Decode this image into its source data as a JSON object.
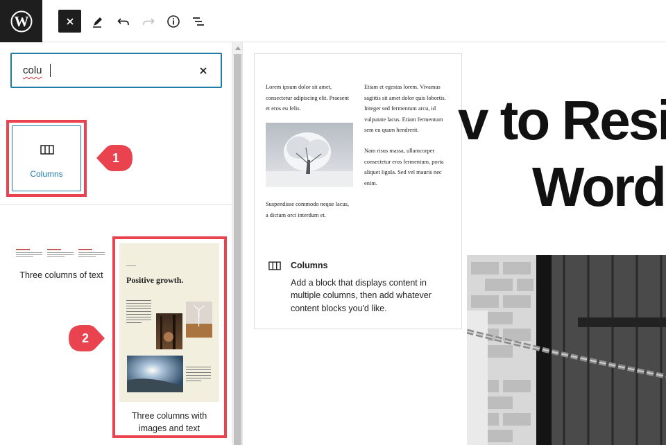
{
  "toolbar": {
    "close_label": "×",
    "icons": [
      "wordpress-logo",
      "close-icon",
      "pencil-icon",
      "undo-icon",
      "redo-icon",
      "info-icon",
      "list-view-icon"
    ]
  },
  "inserter": {
    "search": {
      "value": "colu"
    },
    "block_result": {
      "label": "Columns",
      "icon": "columns-icon"
    },
    "patterns": [
      {
        "label": "Three columns of text"
      },
      {
        "label": "Three columns with images and text",
        "preview_title": "Positive growth."
      }
    ]
  },
  "callouts": [
    "1",
    "2"
  ],
  "preview": {
    "col1_para1": "Lorem ipsum dolor sit amet, consectetur adipiscing elit. Praesent et eros eu felis.",
    "col1_para2": "Suspendisse commodo neque lacus, a dictum orci interdum et.",
    "col2_para1": "Etiam et egestas lorem. Vivamus sagittis sit amet dolor quis lobortis. Integer sed fermentum arcu, id vulputate lacus. Etiam fermentum sem eu quam hendrerit.",
    "col2_para2": "Nam risus massa, ullamcorper consectetur eros fermentum, porta aliquet ligula. Sed vel mauris nec enim.",
    "block_title": "Columns",
    "block_description": "Add a block that displays content in multiple columns, then add whatever content blocks you'd like."
  },
  "canvas": {
    "headline_line1": "v to Resi",
    "headline_line2": "Word"
  },
  "colors": {
    "accent": "#1f7ba8",
    "highlight": "#e8434e",
    "dark": "#1e1e1e"
  }
}
